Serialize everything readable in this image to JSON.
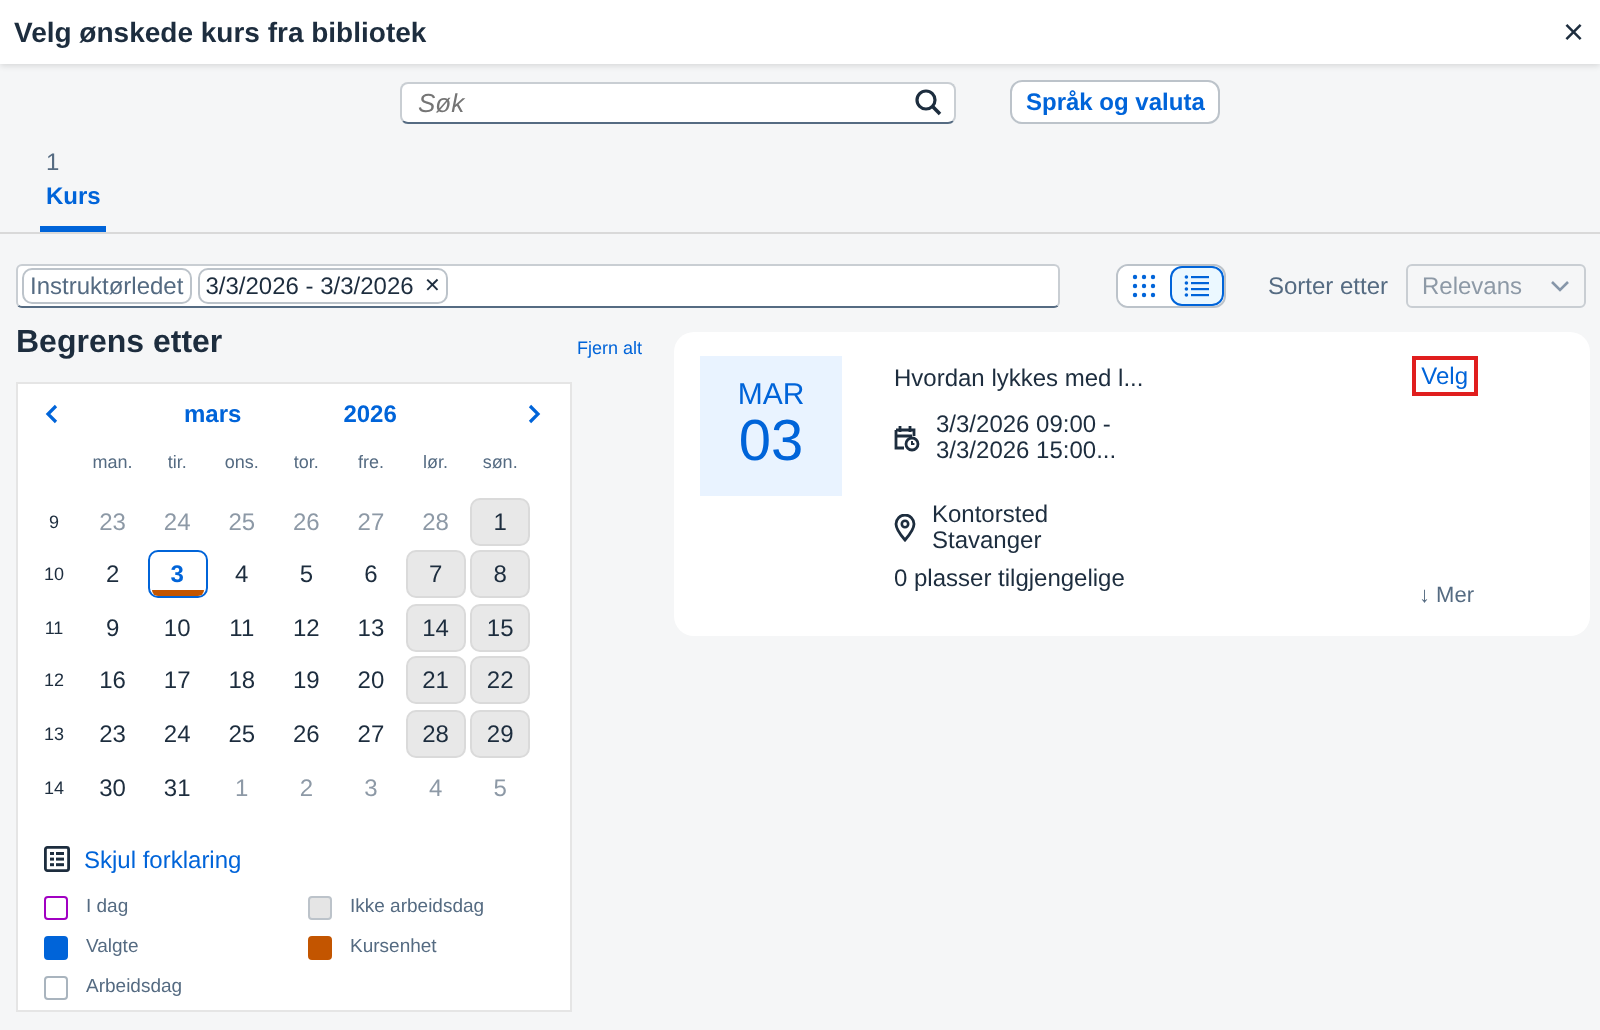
{
  "window": {
    "title": "Velg ønskede kurs fra bibliotek",
    "close": "×"
  },
  "search": {
    "placeholder": "Søk"
  },
  "language_button": "Språk og valuta",
  "tabs": [
    {
      "count": "1",
      "label": "Kurs",
      "selected": true
    }
  ],
  "filter_tokens": [
    {
      "label": "Instruktørledet"
    },
    {
      "label": "3/3/2026 - 3/3/2026",
      "remove": "✕"
    }
  ],
  "view_toggle": [
    {
      "kind": "grid",
      "selected": false
    },
    {
      "kind": "list",
      "selected": true
    }
  ],
  "sort": {
    "label": "Sorter etter",
    "value": "Relevans",
    "disabled": true
  },
  "filters": {
    "title": "Begrens etter",
    "clear": "Fjern alt"
  },
  "calendar": {
    "month": "mars",
    "year": "2026",
    "weekdays": [
      "man.",
      "tir.",
      "ons.",
      "tor.",
      "fre.",
      "lør.",
      "søn."
    ],
    "weeks": [
      {
        "week": "9",
        "days": [
          {
            "d": "23",
            "out": true,
            "off": false,
            "selected": false,
            "course": false
          },
          {
            "d": "24",
            "out": true,
            "off": false,
            "selected": false,
            "course": false
          },
          {
            "d": "25",
            "out": true,
            "off": false,
            "selected": false,
            "course": false
          },
          {
            "d": "26",
            "out": true,
            "off": false,
            "selected": false,
            "course": false
          },
          {
            "d": "27",
            "out": true,
            "off": false,
            "selected": false,
            "course": false
          },
          {
            "d": "28",
            "out": true,
            "off": false,
            "selected": false,
            "course": false
          },
          {
            "d": "1",
            "out": false,
            "off": true,
            "selected": false,
            "course": false
          }
        ]
      },
      {
        "week": "10",
        "days": [
          {
            "d": "2",
            "out": false,
            "off": false,
            "selected": false,
            "course": false
          },
          {
            "d": "3",
            "out": false,
            "off": false,
            "selected": true,
            "course": true
          },
          {
            "d": "4",
            "out": false,
            "off": false,
            "selected": false,
            "course": false
          },
          {
            "d": "5",
            "out": false,
            "off": false,
            "selected": false,
            "course": false
          },
          {
            "d": "6",
            "out": false,
            "off": false,
            "selected": false,
            "course": false
          },
          {
            "d": "7",
            "out": false,
            "off": true,
            "selected": false,
            "course": false
          },
          {
            "d": "8",
            "out": false,
            "off": true,
            "selected": false,
            "course": false
          }
        ]
      },
      {
        "week": "11",
        "days": [
          {
            "d": "9",
            "out": false,
            "off": false,
            "selected": false,
            "course": false
          },
          {
            "d": "10",
            "out": false,
            "off": false,
            "selected": false,
            "course": false
          },
          {
            "d": "11",
            "out": false,
            "off": false,
            "selected": false,
            "course": false
          },
          {
            "d": "12",
            "out": false,
            "off": false,
            "selected": false,
            "course": false
          },
          {
            "d": "13",
            "out": false,
            "off": false,
            "selected": false,
            "course": false
          },
          {
            "d": "14",
            "out": false,
            "off": true,
            "selected": false,
            "course": false
          },
          {
            "d": "15",
            "out": false,
            "off": true,
            "selected": false,
            "course": false
          }
        ]
      },
      {
        "week": "12",
        "days": [
          {
            "d": "16",
            "out": false,
            "off": false,
            "selected": false,
            "course": false
          },
          {
            "d": "17",
            "out": false,
            "off": false,
            "selected": false,
            "course": false
          },
          {
            "d": "18",
            "out": false,
            "off": false,
            "selected": false,
            "course": false
          },
          {
            "d": "19",
            "out": false,
            "off": false,
            "selected": false,
            "course": false
          },
          {
            "d": "20",
            "out": false,
            "off": false,
            "selected": false,
            "course": false
          },
          {
            "d": "21",
            "out": false,
            "off": true,
            "selected": false,
            "course": false
          },
          {
            "d": "22",
            "out": false,
            "off": true,
            "selected": false,
            "course": false
          }
        ]
      },
      {
        "week": "13",
        "days": [
          {
            "d": "23",
            "out": false,
            "off": false,
            "selected": false,
            "course": false
          },
          {
            "d": "24",
            "out": false,
            "off": false,
            "selected": false,
            "course": false
          },
          {
            "d": "25",
            "out": false,
            "off": false,
            "selected": false,
            "course": false
          },
          {
            "d": "26",
            "out": false,
            "off": false,
            "selected": false,
            "course": false
          },
          {
            "d": "27",
            "out": false,
            "off": false,
            "selected": false,
            "course": false
          },
          {
            "d": "28",
            "out": false,
            "off": true,
            "selected": false,
            "course": false
          },
          {
            "d": "29",
            "out": false,
            "off": true,
            "selected": false,
            "course": false
          }
        ]
      },
      {
        "week": "14",
        "days": [
          {
            "d": "30",
            "out": false,
            "off": false,
            "selected": false,
            "course": false
          },
          {
            "d": "31",
            "out": false,
            "off": false,
            "selected": false,
            "course": false
          },
          {
            "d": "1",
            "out": true,
            "off": false,
            "selected": false,
            "course": false
          },
          {
            "d": "2",
            "out": true,
            "off": false,
            "selected": false,
            "course": false
          },
          {
            "d": "3",
            "out": true,
            "off": false,
            "selected": false,
            "course": false
          },
          {
            "d": "4",
            "out": true,
            "off": false,
            "selected": false,
            "course": false
          },
          {
            "d": "5",
            "out": true,
            "off": false,
            "selected": false,
            "course": false
          }
        ]
      }
    ]
  },
  "legend": {
    "toggle": "Skjul forklaring",
    "items": [
      {
        "label": "I dag",
        "kind": "outline",
        "color": "#a100c2"
      },
      {
        "label": "Valgte",
        "kind": "fill",
        "color": "#0064d9"
      },
      {
        "label": "Arbeidsdag",
        "kind": "outline",
        "color": "#a9b4be"
      },
      {
        "label": "Ikke arbeidsdag",
        "kind": "fill",
        "color": "#e5e5e5"
      },
      {
        "label": "Kursenhet",
        "kind": "fill",
        "color": "#c35500"
      }
    ]
  },
  "courses": [
    {
      "month": "MAR",
      "day": "03",
      "title": "Hvordan lykkes med l...",
      "select": "Velg",
      "select_highlighted": true,
      "dates": [
        "3/3/2026 09:00 -",
        "3/3/2026 15:00..."
      ],
      "location": [
        "Kontorsted",
        "Stavanger"
      ],
      "seats": "0 plasser tilgjengelige",
      "more": "↓ Mer"
    }
  ]
}
